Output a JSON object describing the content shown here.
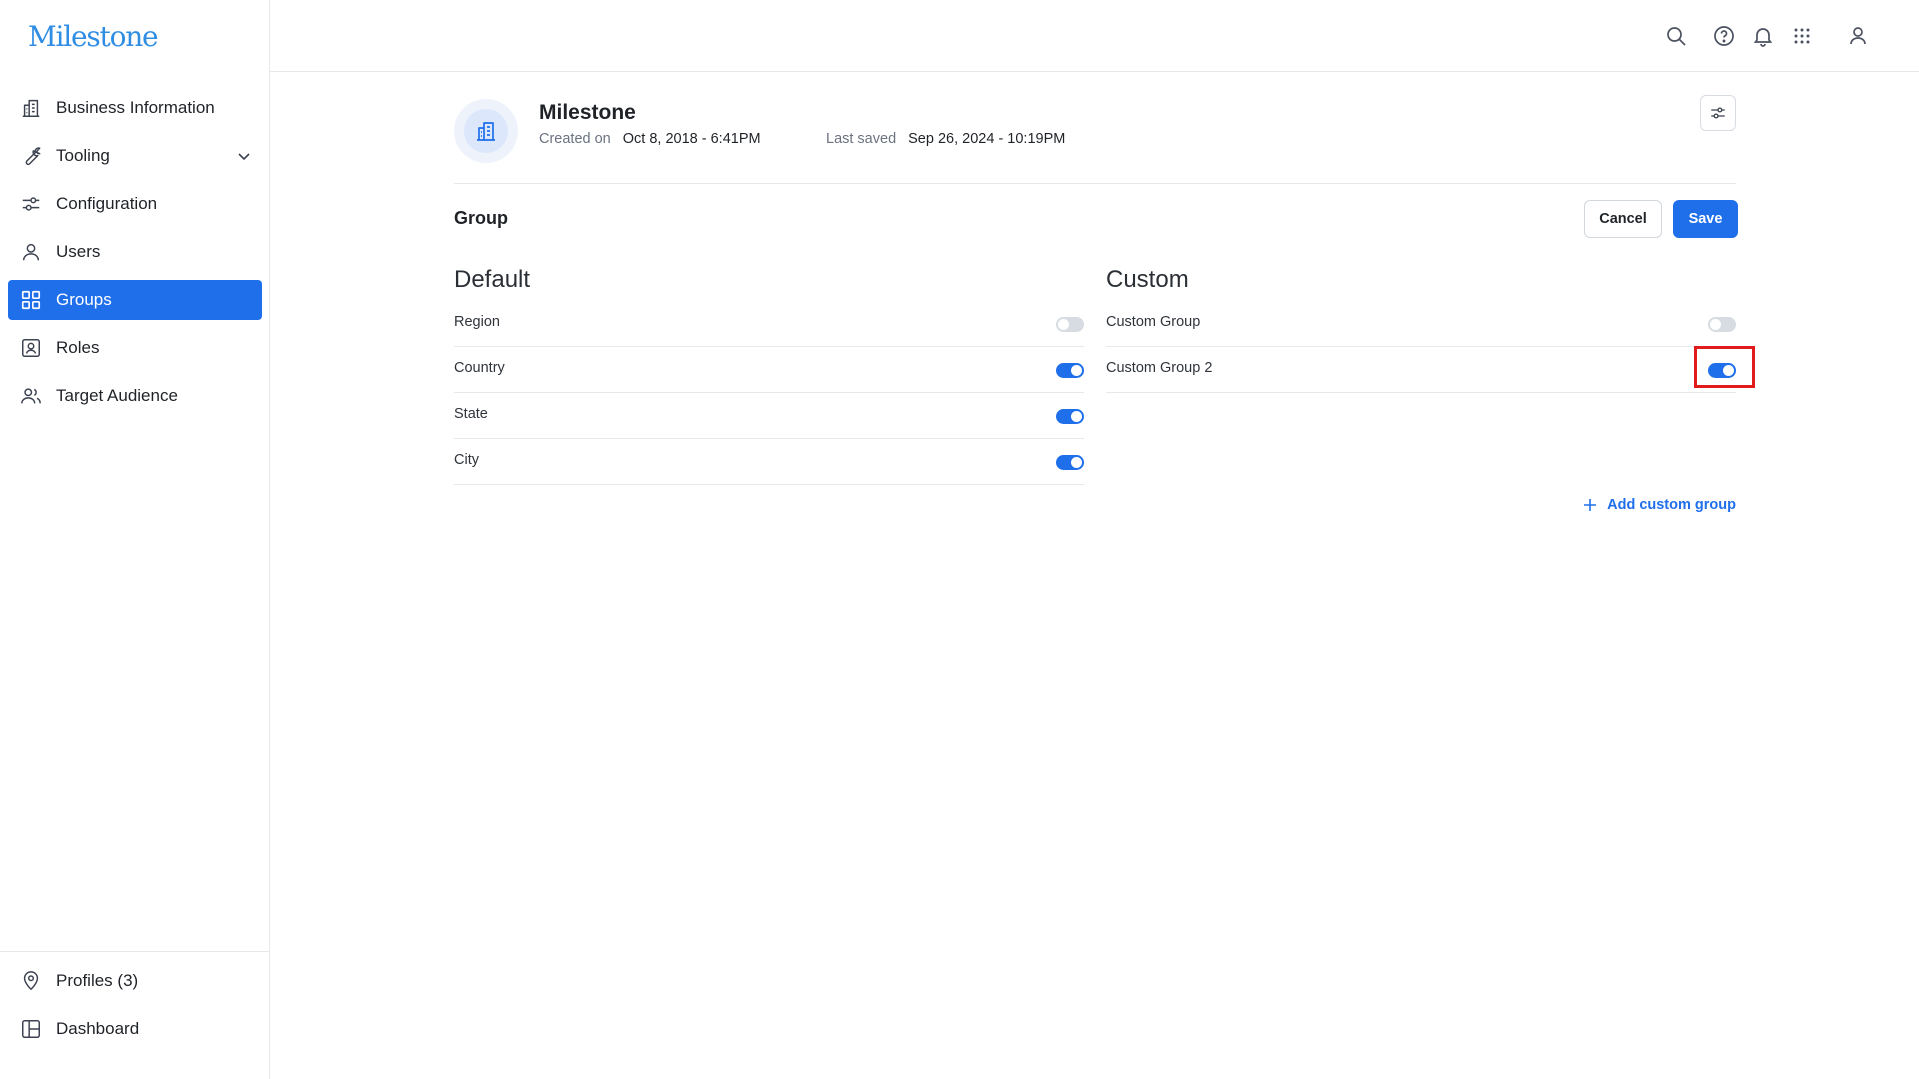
{
  "brand": {
    "logo_text": "Milestone"
  },
  "sidebar": {
    "items": [
      {
        "label": "Business Information",
        "icon": "building-icon"
      },
      {
        "label": "Tooling",
        "icon": "wrench-icon",
        "has_submenu": true
      },
      {
        "label": "Configuration",
        "icon": "sliders-icon"
      },
      {
        "label": "Users",
        "icon": "user-icon"
      },
      {
        "label": "Groups",
        "icon": "grid-icon",
        "active": true
      },
      {
        "label": "Roles",
        "icon": "id-badge-icon"
      },
      {
        "label": "Target Audience",
        "icon": "users-icon"
      }
    ],
    "bottom_items": [
      {
        "label": "Profiles (3)",
        "icon": "map-pin-icon"
      },
      {
        "label": "Dashboard",
        "icon": "layout-icon"
      }
    ]
  },
  "topbar": {
    "icons": [
      "search-icon",
      "help-circle-icon",
      "bell-icon",
      "apps-grid-icon",
      "account-icon"
    ]
  },
  "profile": {
    "name": "Milestone",
    "created_label": "Created on",
    "created_value": "Oct 8, 2018 - 6:41PM",
    "saved_label": "Last saved",
    "saved_value": "Sep 26, 2024 - 10:19PM"
  },
  "section": {
    "title": "Group",
    "cancel_label": "Cancel",
    "save_label": "Save"
  },
  "default_groups": {
    "title": "Default",
    "items": [
      {
        "label": "Region",
        "enabled": false
      },
      {
        "label": "Country",
        "enabled": true
      },
      {
        "label": "State",
        "enabled": true
      },
      {
        "label": "City",
        "enabled": true
      }
    ]
  },
  "custom_groups": {
    "title": "Custom",
    "items": [
      {
        "label": "Custom Group",
        "enabled": false
      },
      {
        "label": "Custom Group 2",
        "enabled": true,
        "highlighted": true
      }
    ],
    "add_label": "Add custom group"
  },
  "colors": {
    "accent": "#1f6feb",
    "highlight_box": "#e11b1b",
    "logo": "#2f8de4"
  }
}
